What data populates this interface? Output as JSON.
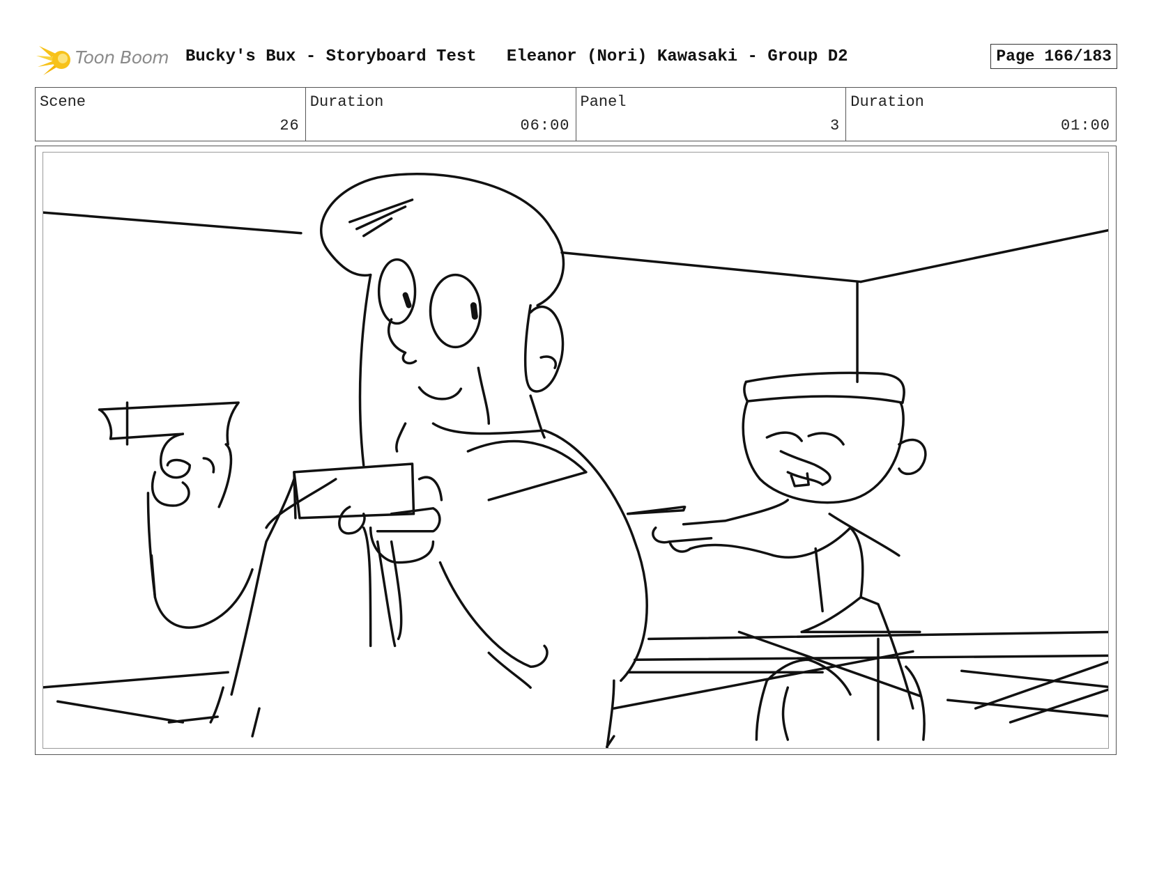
{
  "header": {
    "logo_text": "Toon Boom",
    "project_title": "Bucky's Bux - Storyboard Test",
    "artist": "Eleanor (Nori) Kawasaki - Group D2",
    "page_label": "Page 166/183"
  },
  "info": {
    "scene_label": "Scene",
    "scene_value": "26",
    "scene_duration_label": "Duration",
    "scene_duration_value": "06:00",
    "panel_label": "Panel",
    "panel_value": "3",
    "panel_duration_label": "Duration",
    "panel_duration_value": "01:00"
  },
  "colors": {
    "logo_accent": "#f7c21a",
    "ink": "#111111"
  }
}
